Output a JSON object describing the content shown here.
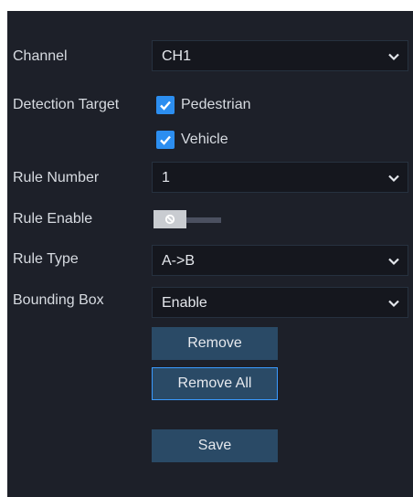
{
  "form": {
    "channel": {
      "label": "Channel",
      "value": "CH1"
    },
    "detection_target": {
      "label": "Detection Target",
      "options": [
        {
          "label": "Pedestrian",
          "checked": true
        },
        {
          "label": "Vehicle",
          "checked": true
        }
      ]
    },
    "rule_number": {
      "label": "Rule Number",
      "value": "1"
    },
    "rule_enable": {
      "label": "Rule Enable",
      "enabled": false
    },
    "rule_type": {
      "label": "Rule Type",
      "value": "A->B"
    },
    "bounding_box": {
      "label": "Bounding Box",
      "value": "Enable"
    }
  },
  "buttons": {
    "remove": "Remove",
    "remove_all": "Remove All",
    "save": "Save"
  },
  "colors": {
    "panel_bg": "#1d2029",
    "field_bg": "#15171e",
    "button_bg": "#2a4a66",
    "checkbox_accent": "#2c8ef0",
    "focus_border": "#3a9bff"
  }
}
